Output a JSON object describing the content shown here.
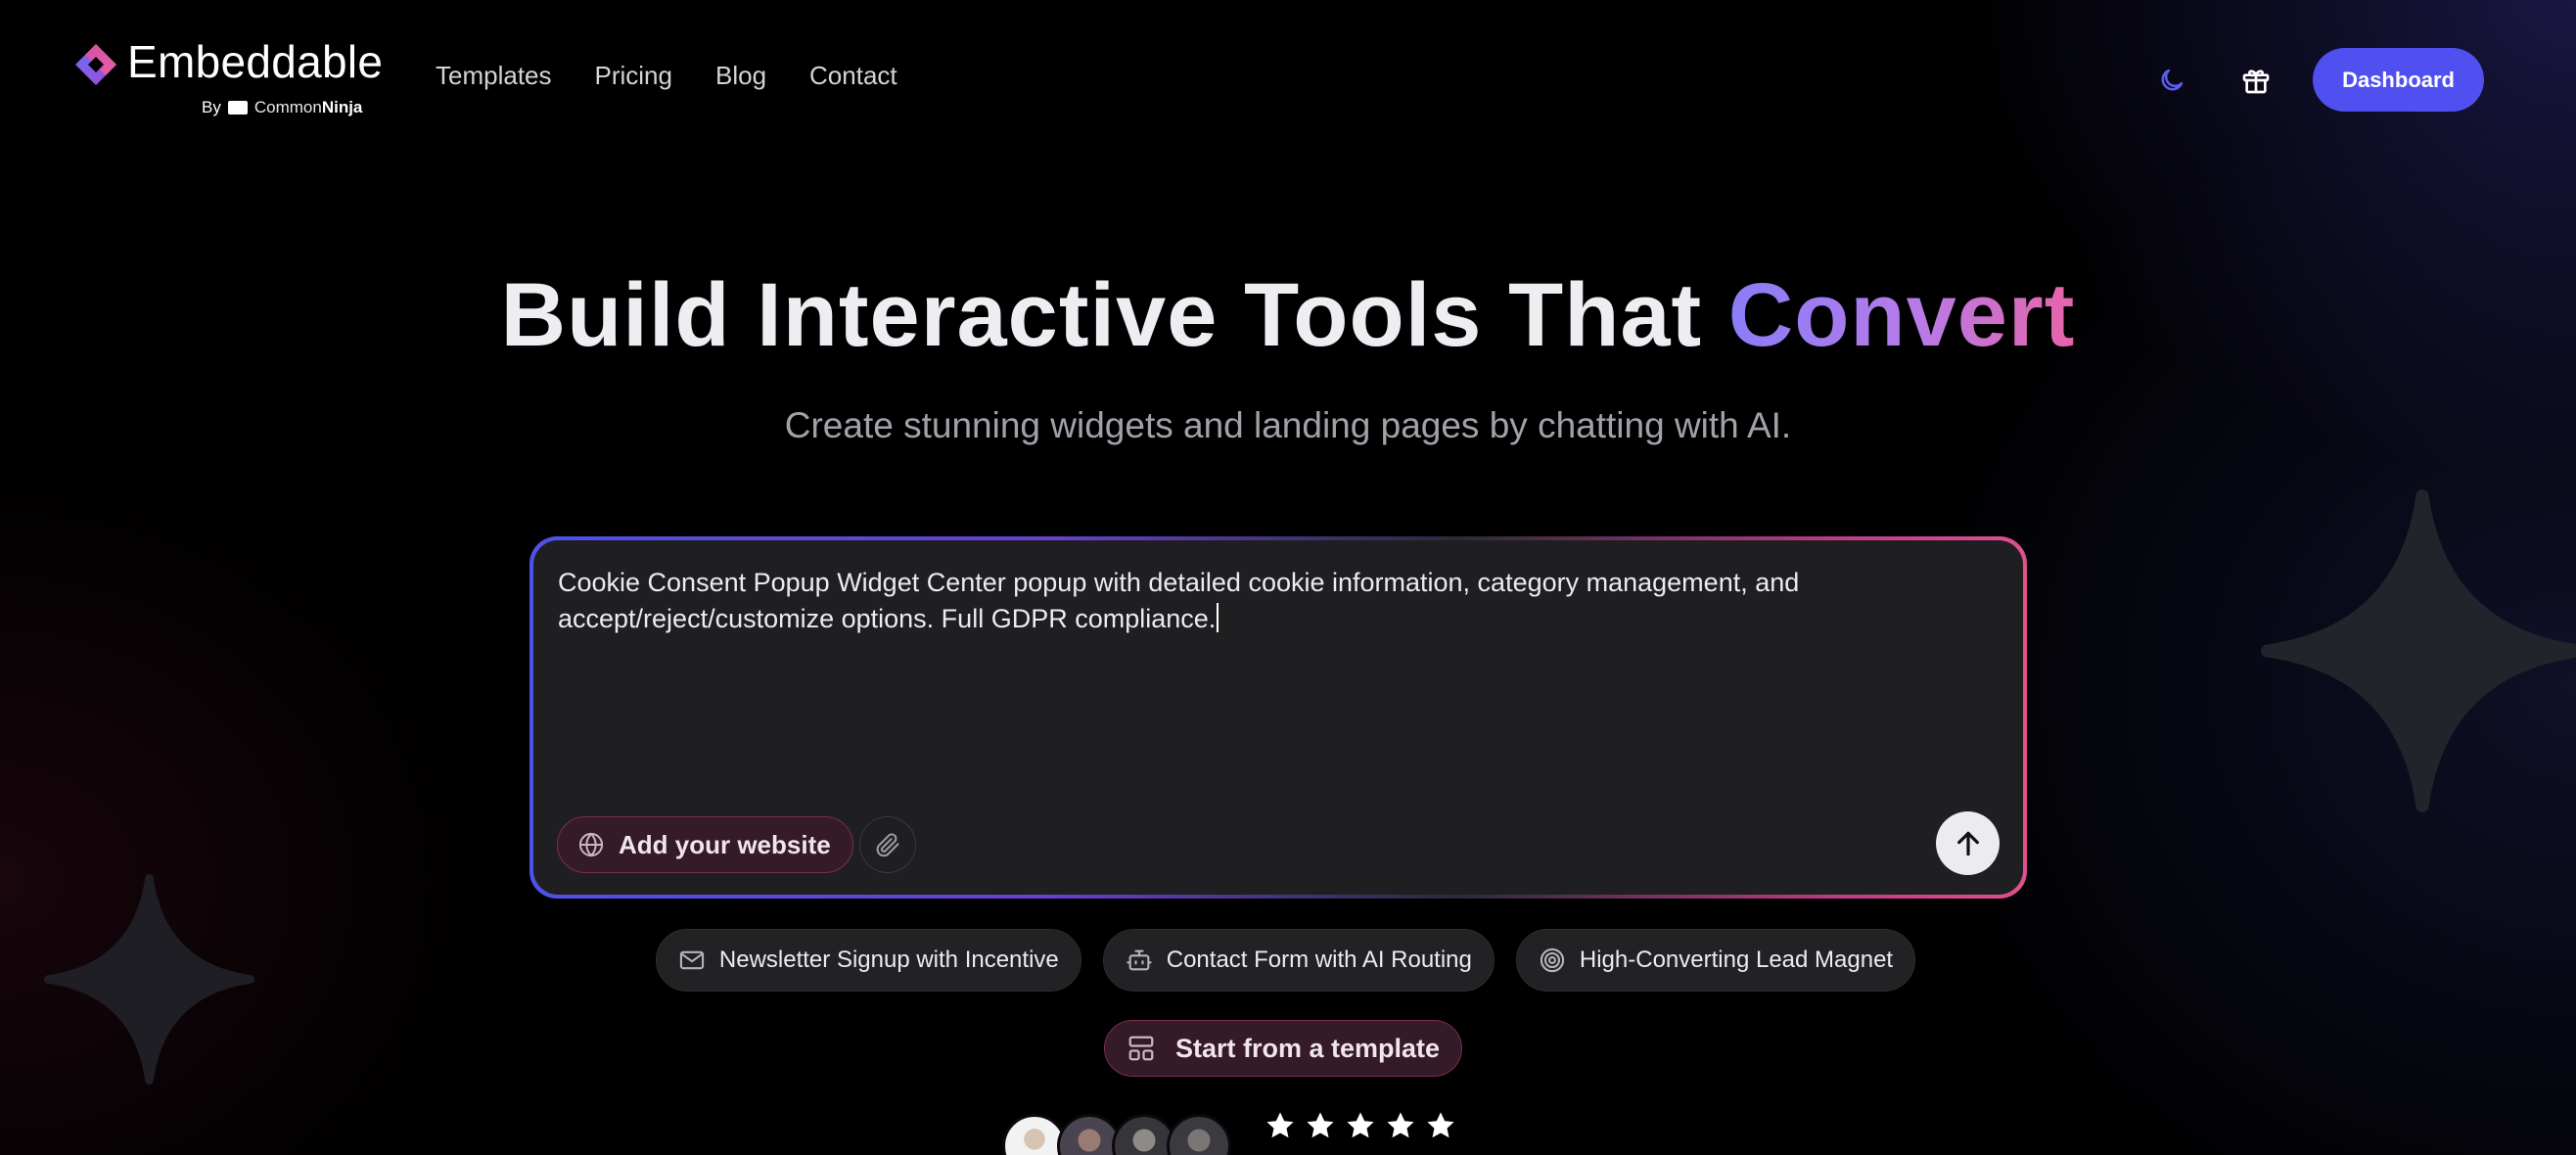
{
  "brand": {
    "name": "Embeddable",
    "by_label": "By",
    "partner_common": "Common",
    "partner_ninja": "Ninja"
  },
  "nav": {
    "items": [
      {
        "label": "Templates"
      },
      {
        "label": "Pricing"
      },
      {
        "label": "Blog"
      },
      {
        "label": "Contact"
      }
    ]
  },
  "header": {
    "dashboard_label": "Dashboard",
    "icons": [
      "moon-icon",
      "gift-icon"
    ]
  },
  "hero": {
    "title_main": "Build Interactive Tools That ",
    "title_accent": "Convert",
    "subtitle": "Create stunning widgets and landing pages by chatting with AI."
  },
  "prompt": {
    "value": "Cookie Consent Popup Widget Center popup with detailed cookie information, category management, and\naccept/reject/customize options. Full GDPR compliance.",
    "add_website_label": "Add your website",
    "icons": [
      "globe-icon",
      "paperclip-icon",
      "arrow-up-icon"
    ]
  },
  "suggestions": [
    {
      "label": "Newsletter Signup with Incentive",
      "icon": "mail-icon"
    },
    {
      "label": "Contact Form with AI Routing",
      "icon": "bot-icon"
    },
    {
      "label": "High-Converting Lead Magnet",
      "icon": "target-icon"
    }
  ],
  "template_button": {
    "label": "Start from a template",
    "icon": "layout-icon"
  },
  "social_proof": {
    "avatar_count": 4,
    "rating": 5,
    "rating_max": 5
  },
  "colors": {
    "background": "#000000",
    "primary": "#5050f0",
    "accent_gradient_start": "#8a7cf7",
    "accent_gradient_end": "#e864a8",
    "chip_bg": "#222224",
    "pink_button_bg": "#351a27"
  }
}
